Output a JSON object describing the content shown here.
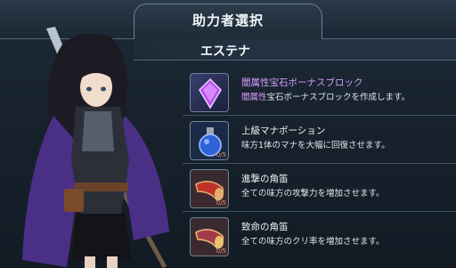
{
  "header": {
    "title": "助力者選択"
  },
  "character": {
    "name": "エステナ"
  },
  "skills": [
    {
      "name": "闇属性宝石ボーナスブロック",
      "desc_highlight": "闇属性",
      "desc_rest": "宝石ボーナスブロックを作成します。",
      "icon": "purple-gem-icon"
    },
    {
      "name": "上級マナポーション",
      "desc": "味方1体のマナを大幅に回復させます。",
      "icon": "mana-potion-icon",
      "count": "0/5"
    },
    {
      "name": "進撃の角笛",
      "desc": "全ての味方の攻撃力を増加させます。",
      "icon": "war-horn-icon",
      "count": "0/5"
    },
    {
      "name": "致命の角笛",
      "desc": "全ての味方のクリ率を増加させます。",
      "icon": "critical-horn-icon",
      "count": "0/5"
    }
  ],
  "colors": {
    "accent_purple": "#d79cff",
    "panel": "#17222d"
  }
}
